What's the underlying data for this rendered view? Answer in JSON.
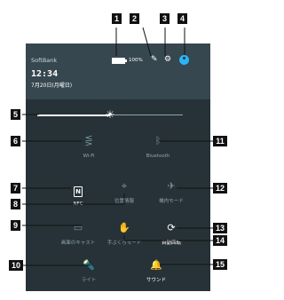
{
  "status": {
    "carrier": "SoftBank",
    "time": "12:34",
    "date": "7月20日(月曜日)",
    "battery_percent": "100%"
  },
  "brightness": {
    "level": 0.5
  },
  "tiles": [
    {
      "id": "wifi",
      "label": "Wi-Fi",
      "icon": "wifi-off-icon",
      "on": false
    },
    {
      "id": "bluetooth",
      "label": "Bluetooth",
      "icon": "bluetooth-off-icon",
      "on": false
    },
    {
      "id": "nfc",
      "label": "NFC",
      "icon": "nfc-icon",
      "on": true
    },
    {
      "id": "location",
      "label": "位置情報",
      "icon": "location-off-icon",
      "on": false
    },
    {
      "id": "airplane",
      "label": "機内モード",
      "icon": "airplane-icon",
      "on": false
    },
    {
      "id": "cast",
      "label": "画面のキャスト",
      "icon": "cast-icon",
      "on": false
    },
    {
      "id": "pocket",
      "label": "手ぶくろモード",
      "icon": "glove-off-icon",
      "on": false
    },
    {
      "id": "rotate",
      "label": "自動回転",
      "icon": "rotate-icon",
      "on": true
    },
    {
      "id": "light",
      "label": "ライト",
      "icon": "flashlight-icon",
      "on": false
    },
    {
      "id": "sound",
      "label": "サウンド",
      "icon": "bell-icon",
      "on": true
    }
  ],
  "callouts": [
    "1",
    "2",
    "3",
    "4",
    "5",
    "6",
    "7",
    "8",
    "9",
    "10",
    "11",
    "12",
    "13",
    "14",
    "15"
  ]
}
